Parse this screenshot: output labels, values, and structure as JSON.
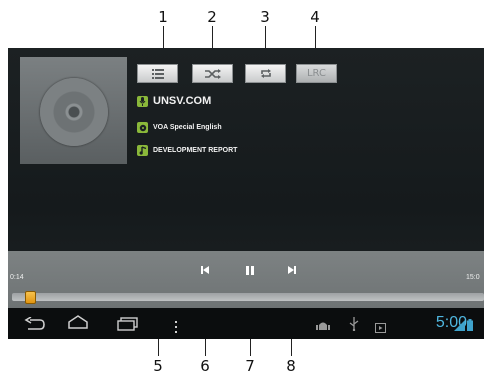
{
  "callouts": {
    "c1": "1",
    "c2": "2",
    "c3": "3",
    "c4": "4",
    "c5": "5",
    "c6": "6",
    "c7": "7",
    "c8": "8"
  },
  "top_buttons": {
    "playlist_icon": "list-icon",
    "shuffle_icon": "shuffle-icon",
    "repeat_icon": "repeat-icon",
    "lyrics_label": "LRC"
  },
  "track_info": {
    "artist": "UNSV.COM",
    "album": "VOA Special English",
    "title": "DEVELOPMENT REPORT"
  },
  "playback": {
    "elapsed": "0:14",
    "duration": "15:0",
    "progress_fraction": 0.02,
    "prev_icon": "skip-previous-icon",
    "pause_icon": "pause-icon",
    "next_icon": "skip-next-icon"
  },
  "navbar": {
    "back_icon": "back-icon",
    "home_icon": "home-icon",
    "recents_icon": "recent-apps-icon",
    "menu_icon": "overflow-menu-icon",
    "clock": "5:00"
  },
  "colors": {
    "accent_clock": "#4fb7e0",
    "info_icon_green": "#8ab83a",
    "thumb_orange": "#f19a12"
  }
}
